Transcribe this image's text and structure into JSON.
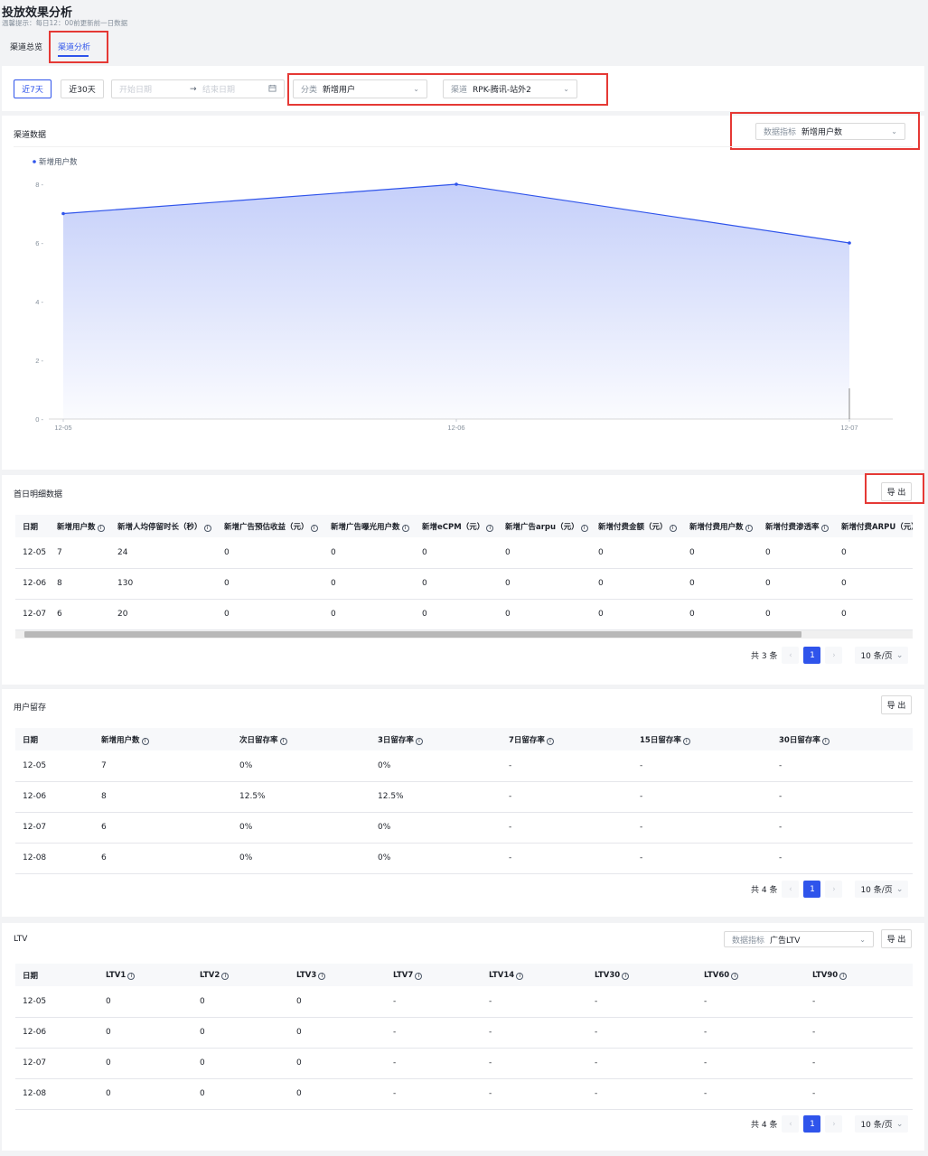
{
  "page": {
    "title": "投放效果分析",
    "notice": "温馨提示：每日12：00前更新前一日数据"
  },
  "tabs": [
    {
      "label": "渠道总览"
    },
    {
      "label": "渠道分析"
    }
  ],
  "filters": {
    "range_7d": "近7天",
    "range_30d": "近30天",
    "start_placeholder": "开始日期",
    "arrow": "→",
    "end_placeholder": "结束日期",
    "category_label": "分类",
    "category_value": "新增用户",
    "channel_label": "渠道",
    "channel_value": "RPK-腾讯-站外2"
  },
  "channel_data": {
    "title": "渠道数据",
    "metric_label": "数据指标",
    "metric_value": "新增用户数"
  },
  "chart_data": {
    "type": "area",
    "x": [
      "12-05",
      "12-06",
      "12-07"
    ],
    "series": [
      {
        "name": "新增用户数",
        "values": [
          7,
          8,
          6
        ]
      }
    ],
    "ylim": [
      0,
      8
    ],
    "yticks": [
      0,
      2,
      4,
      6,
      8
    ],
    "legend": "top-left",
    "color": "#2f54eb"
  },
  "daily": {
    "title": "首日明细数据",
    "export": "导 出",
    "columns": [
      "日期",
      "新增用户数",
      "新增人均停留时长（秒）",
      "新增广告预估收益（元）",
      "新增广告曝光用户数",
      "新增eCPM（元）",
      "新增广告arpu（元）",
      "新增付费金额（元）",
      "新增付费用户数",
      "新增付费渗透率",
      "新增付费ARPU（元）"
    ],
    "rows": [
      [
        "12-05",
        "7",
        "24",
        "0",
        "0",
        "0",
        "0",
        "0",
        "0",
        "0",
        "0"
      ],
      [
        "12-06",
        "8",
        "130",
        "0",
        "0",
        "0",
        "0",
        "0",
        "0",
        "0",
        "0"
      ],
      [
        "12-07",
        "6",
        "20",
        "0",
        "0",
        "0",
        "0",
        "0",
        "0",
        "0",
        "0"
      ]
    ],
    "total": "共 3 条",
    "page": "1",
    "page_size": "10 条/页"
  },
  "retention": {
    "title": "用户留存",
    "export": "导 出",
    "columns": [
      "日期",
      "新增用户数",
      "次日留存率",
      "3日留存率",
      "7日留存率",
      "15日留存率",
      "30日留存率"
    ],
    "rows": [
      [
        "12-05",
        "7",
        "0%",
        "0%",
        "-",
        "-",
        "-"
      ],
      [
        "12-06",
        "8",
        "12.5%",
        "12.5%",
        "-",
        "-",
        "-"
      ],
      [
        "12-07",
        "6",
        "0%",
        "0%",
        "-",
        "-",
        "-"
      ],
      [
        "12-08",
        "6",
        "0%",
        "0%",
        "-",
        "-",
        "-"
      ]
    ],
    "total": "共 4 条",
    "page": "1",
    "page_size": "10 条/页"
  },
  "ltv": {
    "title": "LTV",
    "metric_label": "数据指标",
    "metric_value": "广告LTV",
    "export": "导 出",
    "columns": [
      "日期",
      "LTV1",
      "LTV2",
      "LTV3",
      "LTV7",
      "LTV14",
      "LTV30",
      "LTV60",
      "LTV90"
    ],
    "rows": [
      [
        "12-05",
        "0",
        "0",
        "0",
        "-",
        "-",
        "-",
        "-",
        "-"
      ],
      [
        "12-06",
        "0",
        "0",
        "0",
        "-",
        "-",
        "-",
        "-",
        "-"
      ],
      [
        "12-07",
        "0",
        "0",
        "0",
        "-",
        "-",
        "-",
        "-",
        "-"
      ],
      [
        "12-08",
        "0",
        "0",
        "0",
        "-",
        "-",
        "-",
        "-",
        "-"
      ]
    ],
    "total": "共 4 条",
    "page": "1",
    "page_size": "10 条/页"
  }
}
